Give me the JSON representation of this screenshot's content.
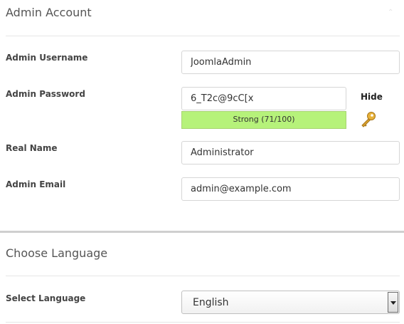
{
  "admin_account": {
    "title": "Admin Account",
    "username_label": "Admin Username",
    "username_value": "JoomlaAdmin",
    "password_label": "Admin Password",
    "password_value": "6_T2c@9cC[x",
    "strength_text": "Strong (71/100)",
    "strength_color": "#b6f27a",
    "hide_label": "Hide",
    "key_icon": "key-icon",
    "realname_label": "Real Name",
    "realname_value": "Administrator",
    "email_label": "Admin Email",
    "email_value": "admin@example.com"
  },
  "language": {
    "title": "Choose Language",
    "select_label": "Select Language",
    "selected": "English"
  }
}
